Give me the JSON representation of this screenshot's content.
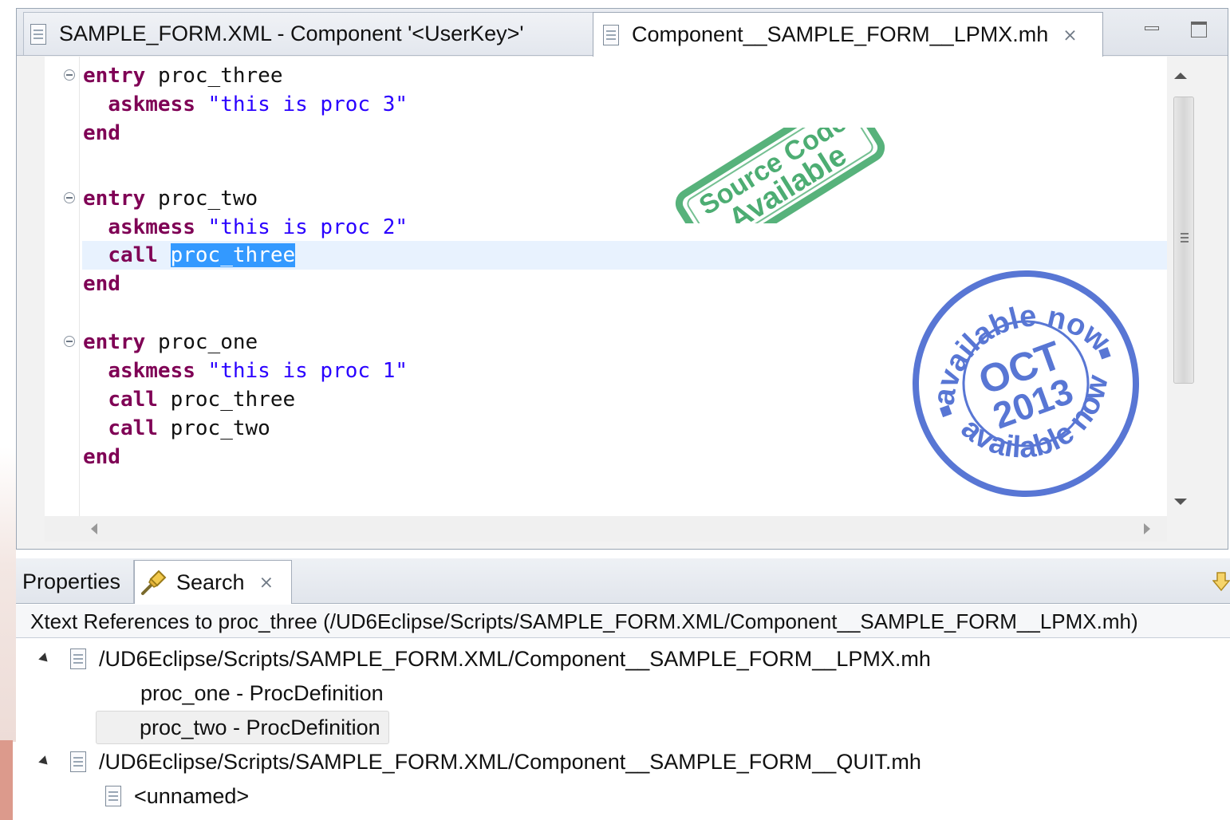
{
  "editor": {
    "tabs": [
      {
        "label": "SAMPLE_FORM.XML - Component '<UserKey>'",
        "active": false
      },
      {
        "label": "Component__SAMPLE_FORM__LPMX.mh",
        "active": true
      }
    ],
    "tab_close_glyph": "⨯",
    "code": {
      "blocks": [
        {
          "entry": "entry",
          "name": "proc_three",
          "lines": [
            {
              "kw": "askmess",
              "arg": "\"this is proc 3\""
            }
          ],
          "end": "end"
        },
        {
          "entry": "entry",
          "name": "proc_two",
          "lines": [
            {
              "kw": "askmess",
              "arg": "\"this is proc 2\""
            },
            {
              "kw": "call",
              "arg": "proc_three",
              "selected": true
            }
          ],
          "end": "end"
        },
        {
          "entry": "entry",
          "name": "proc_one",
          "lines": [
            {
              "kw": "askmess",
              "arg": "\"this is proc 1\""
            },
            {
              "kw": "call",
              "arg": "proc_three"
            },
            {
              "kw": "call",
              "arg": "proc_two"
            }
          ],
          "end": "end"
        }
      ]
    },
    "stamps": {
      "source_code": {
        "line1": "Source Code",
        "line2": "Available",
        "color": "#3aa564"
      },
      "date": {
        "month": "OCT",
        "year": "2013",
        "ring_text": "available now",
        "color": "#3c5fcd"
      }
    }
  },
  "search_view": {
    "tabs": [
      {
        "label": "Properties",
        "active": false
      },
      {
        "label": "Search",
        "active": true,
        "close_glyph": "⨯"
      }
    ],
    "header": "Xtext References to proc_three (/UD6Eclipse/Scripts/SAMPLE_FORM.XML/Component__SAMPLE_FORM__LPMX.mh)",
    "results": [
      {
        "path": "/UD6Eclipse/Scripts/SAMPLE_FORM.XML/Component__SAMPLE_FORM__LPMX.mh",
        "expanded": true,
        "children": [
          {
            "label": "proc_one - ProcDefinition",
            "selected": false
          },
          {
            "label": "proc_two - ProcDefinition",
            "selected": true
          }
        ]
      },
      {
        "path": "/UD6Eclipse/Scripts/SAMPLE_FORM.XML/Component__SAMPLE_FORM__QUIT.mh",
        "expanded": true,
        "children": [
          {
            "label": "<unnamed>",
            "selected": false
          }
        ]
      }
    ]
  },
  "colors": {
    "keyword": "#7f0055",
    "string": "#2a00ff",
    "selection": "#3399ff",
    "current_line": "#e8f2fe"
  }
}
